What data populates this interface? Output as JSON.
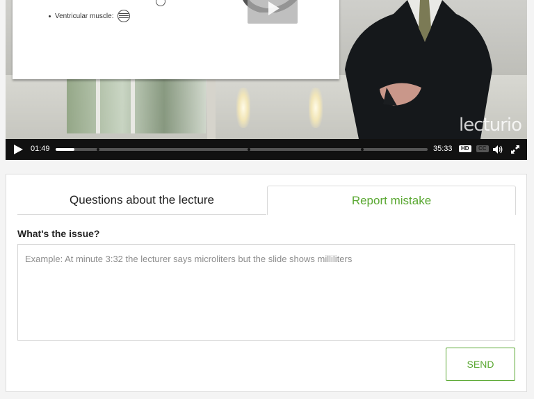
{
  "video": {
    "slide": {
      "bullet_label": "Ventricular muscle:"
    },
    "watermark": "lecturio",
    "controls": {
      "current_time": "01:49",
      "duration": "35:33",
      "progress_fraction": 0.05,
      "chapter_markers": [
        0.11,
        0.516,
        0.82
      ],
      "hd_label": "HD",
      "cc_label": "CC",
      "icons": [
        "play-icon",
        "volume-icon",
        "fullscreen-icon"
      ]
    }
  },
  "tabs": {
    "questions_label": "Questions about the lecture",
    "report_label": "Report mistake",
    "active": "report"
  },
  "report": {
    "issue_label": "What's the issue?",
    "issue_value": "",
    "issue_placeholder": "Example: At minute 3:32 the lecturer says microliters but the slide shows milliliters",
    "send_label": "SEND"
  },
  "colors": {
    "accent_green": "#5aa832",
    "control_bar": "#111111"
  }
}
